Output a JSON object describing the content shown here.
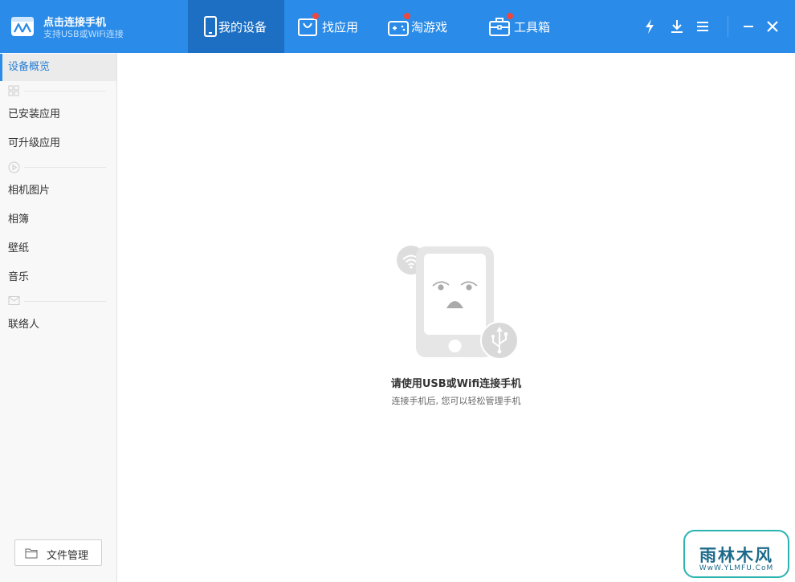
{
  "app": {
    "title": "点击连接手机",
    "subtitle": "支持USB或WiFi连接",
    "logo_icon": "phone-link-logo-icon",
    "accent_color": "#2a8be8"
  },
  "nav": {
    "tabs": [
      {
        "label": "我的设备",
        "icon": "device-icon",
        "active": true,
        "badge": false
      },
      {
        "label": "找应用",
        "icon": "app-bag-icon",
        "active": false,
        "badge": true
      },
      {
        "label": "淘游戏",
        "icon": "gamepad-icon",
        "active": false,
        "badge": true
      },
      {
        "label": "工具箱",
        "icon": "toolbox-icon",
        "active": false,
        "badge": true
      }
    ],
    "badge_color": "#f0463b"
  },
  "window_controls": [
    "flash-icon",
    "download-icon",
    "menu-icon",
    "minimize-icon",
    "close-icon"
  ],
  "sidebar": {
    "items": [
      {
        "label": "设备概览",
        "active": true
      },
      {
        "label": "已安装应用"
      },
      {
        "label": "可升级应用"
      },
      {
        "label": "相机图片"
      },
      {
        "label": "相簿"
      },
      {
        "label": "壁纸"
      },
      {
        "label": "音乐"
      },
      {
        "label": "联络人"
      }
    ],
    "group_icons": [
      "apps-grid-icon",
      "media-play-icon",
      "mail-icon"
    ],
    "file_manager": "文件管理"
  },
  "main": {
    "title": "请使用USB或Wifi连接手机",
    "subtitle": "连接手机后, 您可以轻松管理手机"
  },
  "watermark": {
    "main": "雨林木风",
    "sub": "WwW.YLMFU.CoM"
  }
}
